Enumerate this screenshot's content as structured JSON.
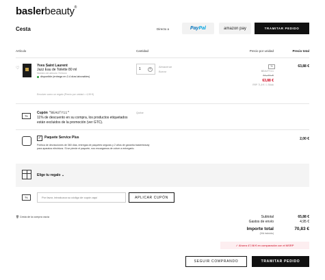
{
  "header": {
    "logo_bold": "basler",
    "logo_light": "beauty",
    "logo_mark": "®",
    "title": "Cesta",
    "direct_label": "Directo a",
    "paypal_a": "Pay",
    "paypal_b": "Pal",
    "amazon_label": "amazon pay",
    "checkout_label": "TRAMITAR PEDIDO"
  },
  "columns": {
    "article": "Artículo",
    "quantity": "Cantidad",
    "unit_price": "Precio por unidad",
    "total": "Precio total"
  },
  "item": {
    "brand": "Yves Saint Laurent",
    "name": "Jazz Eau de Toilette 80 ml",
    "sku": "Número de artículo 742xxxx",
    "availability": "disponible (entrega en 2-4 días laborables)",
    "quantity": "1",
    "action_wishlist": "Almacenar",
    "action_remove": "Borrar",
    "gift_wrap_note": "Envolver como un regalo (Precio por unidad = 4,99 €)",
    "unit_badge": "%",
    "unit_coupon_code": "BEAUTY11",
    "unit_old_price": "71,27 €",
    "unit_price": "63,88 €",
    "unit_rrp": "RRP 71,8 € / 1 Stück",
    "total": "63,88 €"
  },
  "coupon": {
    "icon_text": "%",
    "title": "Cupón",
    "code": "\"BEAUTY11\"",
    "description": "11% de descuento en su compra, los productos etiquetados están excluidos de la promoción (ver GTC).",
    "delete": "Quitar"
  },
  "service": {
    "check": "✓",
    "title": "Paquete Service Plus",
    "description": "Política de devoluciones de 360 días, entregas de paquetes seguras y 2 años de garantía baslerbeauty para aparatos eléctricos. Si se pierde el paquete, nos encargamos de volver a entregarlo.",
    "price": "2,00 €"
  },
  "gift": {
    "label": "Elige tu regalo",
    "chevron": "⌄"
  },
  "coupon_entry": {
    "icon_text": "%",
    "placeholder": "Por favor, introduzca su código de cupón aquí",
    "apply_label": "APLICAR CUPÓN"
  },
  "empty_cart": "Cesta de la compra vacía",
  "summary": {
    "subtotal_label": "Subtotal",
    "subtotal": "65,88 €",
    "shipping_label": "Gastos de envío",
    "shipping": "4,95 €",
    "total_label": "Importe total",
    "total": "70,83 €",
    "vat": "(IVA incluido)",
    "savings": "✓ Ahorra 47,98 € en comparación con el MSRP"
  },
  "footer": {
    "continue_label": "SEGUIR COMPRANDO",
    "checkout_label": "TRAMITAR PEDIDO"
  },
  "colors": {
    "accent": "#d0021b",
    "dark": "#111111",
    "band": "#f4f4f4"
  }
}
